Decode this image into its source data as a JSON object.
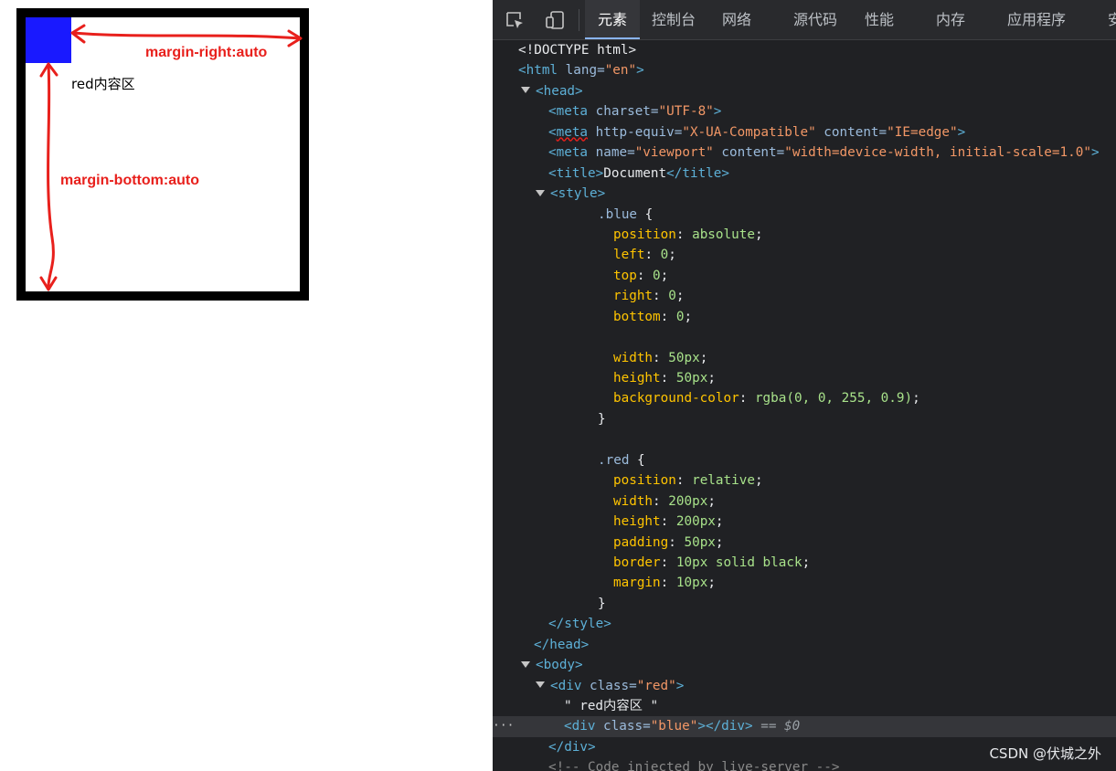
{
  "preview": {
    "red_content": "red内容区",
    "annotation_right": "margin-right:auto",
    "annotation_bottom": "margin-bottom:auto"
  },
  "devtools": {
    "tabs": [
      "元素",
      "控制台",
      "网络",
      "源代码",
      "性能",
      "内存",
      "应用程序",
      "安"
    ],
    "active_tab": "元素",
    "code": {
      "doctype": "<!DOCTYPE html>",
      "html_tag": "html",
      "html_attr": "lang",
      "html_val": "\"en\"",
      "head": "head",
      "meta1_attr": "charset",
      "meta1_val": "\"UTF-8\"",
      "meta2_attr1": "http-equiv",
      "meta2_val1": "\"X-UA-Compatible\"",
      "meta2_attr2": "content",
      "meta2_val2": "\"IE=edge\"",
      "meta3_attr1": "name",
      "meta3_val1": "\"viewport\"",
      "meta3_attr2": "content",
      "meta3_val2": "\"width=device-width, initial-scale=1.0\"",
      "title_text": "Document",
      "style": "style",
      "blue_selector": ".blue",
      "blue_rules": [
        {
          "prop": "position",
          "val": "absolute"
        },
        {
          "prop": "left",
          "val": "0"
        },
        {
          "prop": "top",
          "val": "0"
        },
        {
          "prop": "right",
          "val": "0"
        },
        {
          "prop": "bottom",
          "val": "0"
        },
        {
          "prop": "width",
          "val": "50px"
        },
        {
          "prop": "height",
          "val": "50px"
        },
        {
          "prop": "background-color",
          "val": "rgba(0, 0, 255, 0.9)"
        }
      ],
      "red_selector": ".red",
      "red_rules": [
        {
          "prop": "position",
          "val": "relative"
        },
        {
          "prop": "width",
          "val": "200px"
        },
        {
          "prop": "height",
          "val": "200px"
        },
        {
          "prop": "padding",
          "val": "50px"
        },
        {
          "prop": "border",
          "val": "10px solid black"
        },
        {
          "prop": "margin",
          "val": "10px"
        }
      ],
      "body": "body",
      "div_red_class": "\"red\"",
      "text_node": "\" red内容区 \"",
      "div_blue_class": "\"blue\"",
      "selected_marker": "== $0",
      "comment": "<!-- Code injected by live-server -->"
    },
    "watermark": "CSDN @伏城之外"
  }
}
